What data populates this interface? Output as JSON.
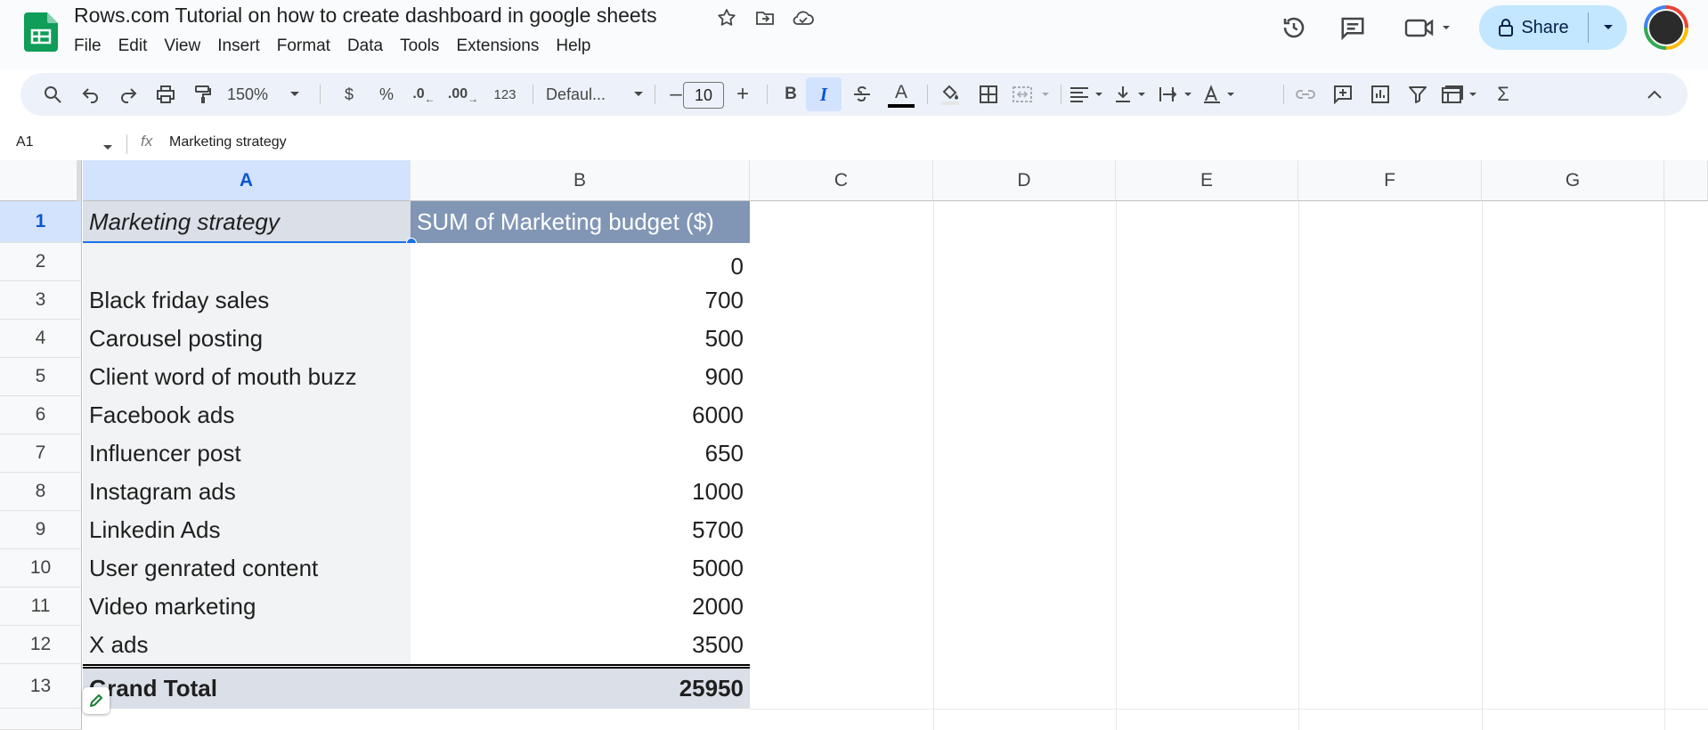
{
  "app": {
    "doc_title": "Rows.com Tutorial on how to create dashboard in google sheets",
    "menu": [
      "File",
      "Edit",
      "View",
      "Insert",
      "Format",
      "Data",
      "Tools",
      "Extensions",
      "Help"
    ],
    "share_label": "Share"
  },
  "toolbar": {
    "zoom": "150%",
    "currency": "$",
    "percent": "%",
    "decrease_decimal": ".0",
    "increase_decimal": ".00",
    "number_format": "123",
    "font": "Defaul...",
    "font_size": "10",
    "bold": "B",
    "italic": "I",
    "text_color_letter": "A"
  },
  "formula_bar": {
    "name_box": "A1",
    "fx": "fx",
    "content": "Marketing strategy"
  },
  "columns": [
    "A",
    "B",
    "C",
    "D",
    "E",
    "F",
    "G"
  ],
  "rows": [
    "1",
    "2",
    "3",
    "4",
    "5",
    "6",
    "7",
    "8",
    "9",
    "10",
    "11",
    "12",
    "13"
  ],
  "pivot": {
    "header_a": "Marketing strategy",
    "header_b": "SUM of Marketing budget ($)",
    "items": [
      {
        "label": "",
        "value": "0"
      },
      {
        "label": "Black friday sales",
        "value": "700"
      },
      {
        "label": "Carousel posting",
        "value": "500"
      },
      {
        "label": "Client word of mouth buzz",
        "value": "900"
      },
      {
        "label": "Facebook ads",
        "value": "6000"
      },
      {
        "label": "Influencer post",
        "value": "650"
      },
      {
        "label": "Instagram ads",
        "value": "1000"
      },
      {
        "label": "Linkedin Ads",
        "value": "5700"
      },
      {
        "label": "User genrated content",
        "value": "5000"
      },
      {
        "label": "Video marketing",
        "value": "2000"
      },
      {
        "label": "X ads",
        "value": "3500"
      }
    ],
    "total_label": "Grand Total",
    "total_value": "25950"
  },
  "colors": {
    "header_bg": "#8196b5",
    "total_bg": "#dadfe8",
    "selection": "#1a73e8",
    "share_bg": "#c2e7ff"
  }
}
